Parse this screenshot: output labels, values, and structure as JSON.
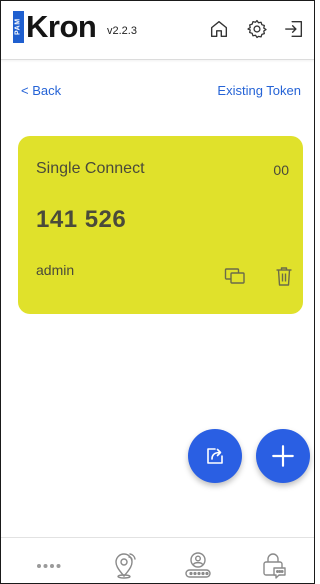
{
  "header": {
    "logo_badge": "PAM",
    "logo_text": "Kron",
    "version": "v2.2.3",
    "icons": [
      "home-icon",
      "gear-icon",
      "logout-icon"
    ]
  },
  "nav": {
    "back_label": "< Back",
    "existing_token_label": "Existing Token"
  },
  "token_card": {
    "name": "Single Connect",
    "counter": "00",
    "code": "141 526",
    "user": "admin",
    "color": "#e0e12b",
    "icons": [
      "copy-icon",
      "trash-icon"
    ]
  },
  "fabs": {
    "color": "#2a5fe3",
    "icons": [
      "share-icon",
      "plus-icon"
    ]
  },
  "bottom_nav": {
    "icons": [
      "dots-icon",
      "location-icon",
      "user-badge-icon",
      "lock-chat-icon"
    ]
  },
  "colors": {
    "link": "#2563d6",
    "brand_blue": "#1f5fcf"
  }
}
